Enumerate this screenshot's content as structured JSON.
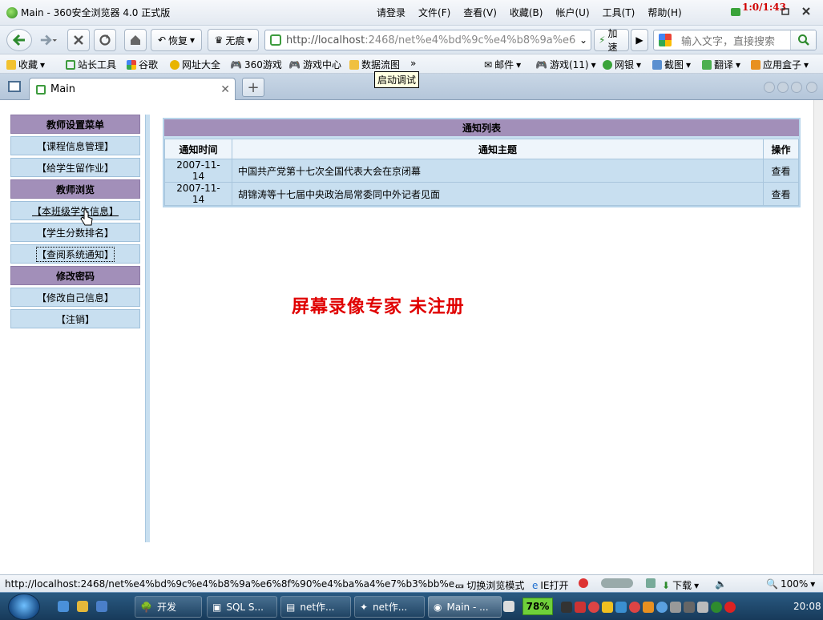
{
  "window": {
    "title": "Main - 360安全浏览器 4.0 正式版",
    "menus": [
      "请登录",
      "文件(F)",
      "查看(V)",
      "收藏(B)",
      "帐户(U)",
      "工具(T)",
      "帮助(H)"
    ],
    "recorder_timer": "1:0/1:43"
  },
  "toolbar": {
    "restore_label": "恢复",
    "private_label": "无痕",
    "address_prefix": "http://localhost",
    "address_rest": ":2468/net%e4%bd%9c%e4%b8%9a%e6",
    "accelerate_label": "加速",
    "search_placeholder": "输入文字，直接搜索"
  },
  "favbar": {
    "items": [
      "收藏",
      "站长工具",
      "谷歌",
      "网址大全",
      "360游戏",
      "游戏中心",
      "数据流图"
    ],
    "more": "»",
    "right_items": [
      "邮件",
      "游戏(11)",
      "网银",
      "截图",
      "翻译",
      "应用盒子"
    ],
    "tooltip": "启动调试"
  },
  "tabs": [
    {
      "label": "Main"
    }
  ],
  "sidebar": {
    "sections": [
      {
        "header": "教师设置菜单",
        "items": [
          "【课程信息管理】",
          "【给学生留作业】"
        ]
      },
      {
        "header": "教师浏览",
        "items": [
          "【本班级学生信息】",
          "【学生分数排名】",
          "【查阅系统通知】"
        ]
      },
      {
        "header": "修改密码",
        "items": [
          "【修改自己信息】",
          "【注销】"
        ]
      }
    ]
  },
  "notices": {
    "title": "通知列表",
    "columns": [
      "通知时间",
      "通知主题",
      "操作"
    ],
    "rows": [
      {
        "date": "2007-11-14",
        "subject": "中国共产党第十七次全国代表大会在京闭幕",
        "action": "查看"
      },
      {
        "date": "2007-11-14",
        "subject": "胡锦涛等十七届中央政治局常委同中外记者见面",
        "action": "查看"
      }
    ]
  },
  "watermark": "屏幕录像专家  未注册",
  "status": {
    "url": "http://localhost:2468/net%e4%bd%9c%e4%b8%9a%e6%8f%90%e4%ba%a4%e7%b3%bb%e...",
    "mode_switch": "切换浏览模式",
    "ie_open": "IE打开",
    "download": "下载",
    "zoom": "100%"
  },
  "taskbar": {
    "buttons": [
      "开发",
      "SQL S...",
      "net作...",
      "net作...",
      "Main - ..."
    ],
    "battery": "78%",
    "clock": "20:08"
  }
}
